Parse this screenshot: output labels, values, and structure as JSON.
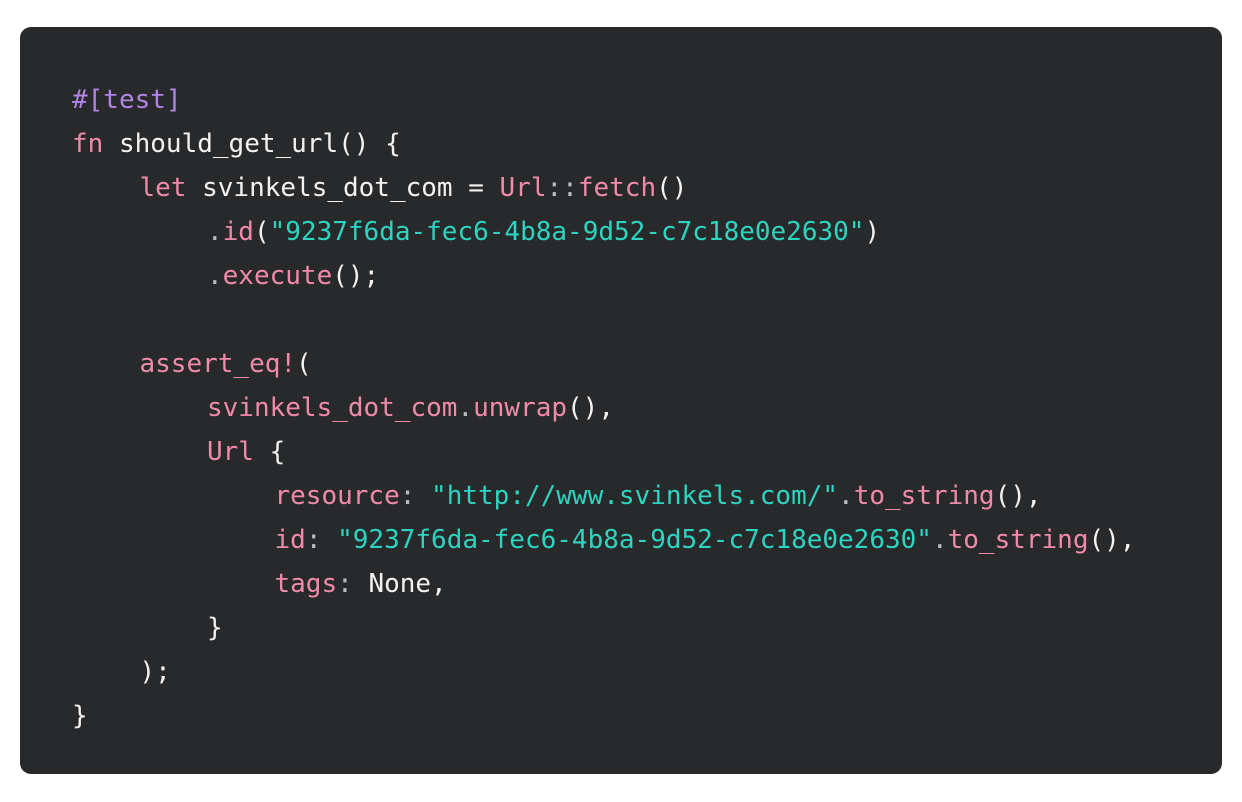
{
  "colors": {
    "background": "#28292b",
    "text": "#f2f2f2",
    "keyword": "#f08aab",
    "string": "#2dd4bf",
    "attribute": "#b085e6",
    "punctuation": "#b9bcc3"
  },
  "code": {
    "language": "rust",
    "lines": [
      {
        "indent": 0,
        "tokens": [
          {
            "t": "#[test]",
            "k": "attribute"
          }
        ]
      },
      {
        "indent": 0,
        "tokens": [
          {
            "t": "fn",
            "k": "keyword"
          },
          {
            "t": " should_get_url() {",
            "k": "text"
          }
        ]
      },
      {
        "indent": 1,
        "tokens": [
          {
            "t": "let",
            "k": "keyword"
          },
          {
            "t": " svinkels_dot_com = ",
            "k": "text"
          },
          {
            "t": "Url",
            "k": "keyword"
          },
          {
            "t": "::",
            "k": "punctuation"
          },
          {
            "t": "fetch",
            "k": "keyword"
          },
          {
            "t": "()",
            "k": "text"
          }
        ]
      },
      {
        "indent": 2,
        "tokens": [
          {
            "t": ".",
            "k": "punctuation"
          },
          {
            "t": "id",
            "k": "keyword"
          },
          {
            "t": "(",
            "k": "text"
          },
          {
            "t": "\"9237f6da-fec6-4b8a-9d52-c7c18e0e2630\"",
            "k": "string"
          },
          {
            "t": ")",
            "k": "text"
          }
        ]
      },
      {
        "indent": 2,
        "tokens": [
          {
            "t": ".",
            "k": "punctuation"
          },
          {
            "t": "execute",
            "k": "keyword"
          },
          {
            "t": "();",
            "k": "text"
          }
        ]
      },
      {
        "indent": 0,
        "tokens": []
      },
      {
        "indent": 1,
        "tokens": [
          {
            "t": "assert_eq!",
            "k": "keyword"
          },
          {
            "t": "(",
            "k": "text"
          }
        ]
      },
      {
        "indent": 2,
        "tokens": [
          {
            "t": "svinkels_dot_com",
            "k": "keyword"
          },
          {
            "t": ".",
            "k": "punctuation"
          },
          {
            "t": "unwrap",
            "k": "keyword"
          },
          {
            "t": "(),",
            "k": "text"
          }
        ]
      },
      {
        "indent": 2,
        "tokens": [
          {
            "t": "Url",
            "k": "keyword"
          },
          {
            "t": " {",
            "k": "text"
          }
        ]
      },
      {
        "indent": 3,
        "tokens": [
          {
            "t": "resource",
            "k": "keyword"
          },
          {
            "t": ": ",
            "k": "punctuation"
          },
          {
            "t": "\"http://www.svinkels.com/\"",
            "k": "string"
          },
          {
            "t": ".",
            "k": "punctuation"
          },
          {
            "t": "to_string",
            "k": "keyword"
          },
          {
            "t": "(),",
            "k": "text"
          }
        ]
      },
      {
        "indent": 3,
        "tokens": [
          {
            "t": "id",
            "k": "keyword"
          },
          {
            "t": ": ",
            "k": "punctuation"
          },
          {
            "t": "\"9237f6da-fec6-4b8a-9d52-c7c18e0e2630\"",
            "k": "string"
          },
          {
            "t": ".",
            "k": "punctuation"
          },
          {
            "t": "to_string",
            "k": "keyword"
          },
          {
            "t": "(),",
            "k": "text"
          }
        ]
      },
      {
        "indent": 3,
        "tokens": [
          {
            "t": "tags",
            "k": "keyword"
          },
          {
            "t": ": ",
            "k": "punctuation"
          },
          {
            "t": "None,",
            "k": "text"
          }
        ]
      },
      {
        "indent": 2,
        "tokens": [
          {
            "t": "}",
            "k": "text"
          }
        ]
      },
      {
        "indent": 1,
        "tokens": [
          {
            "t": ");",
            "k": "text"
          }
        ]
      },
      {
        "indent": 0,
        "tokens": [
          {
            "t": "}",
            "k": "text"
          }
        ]
      }
    ]
  }
}
